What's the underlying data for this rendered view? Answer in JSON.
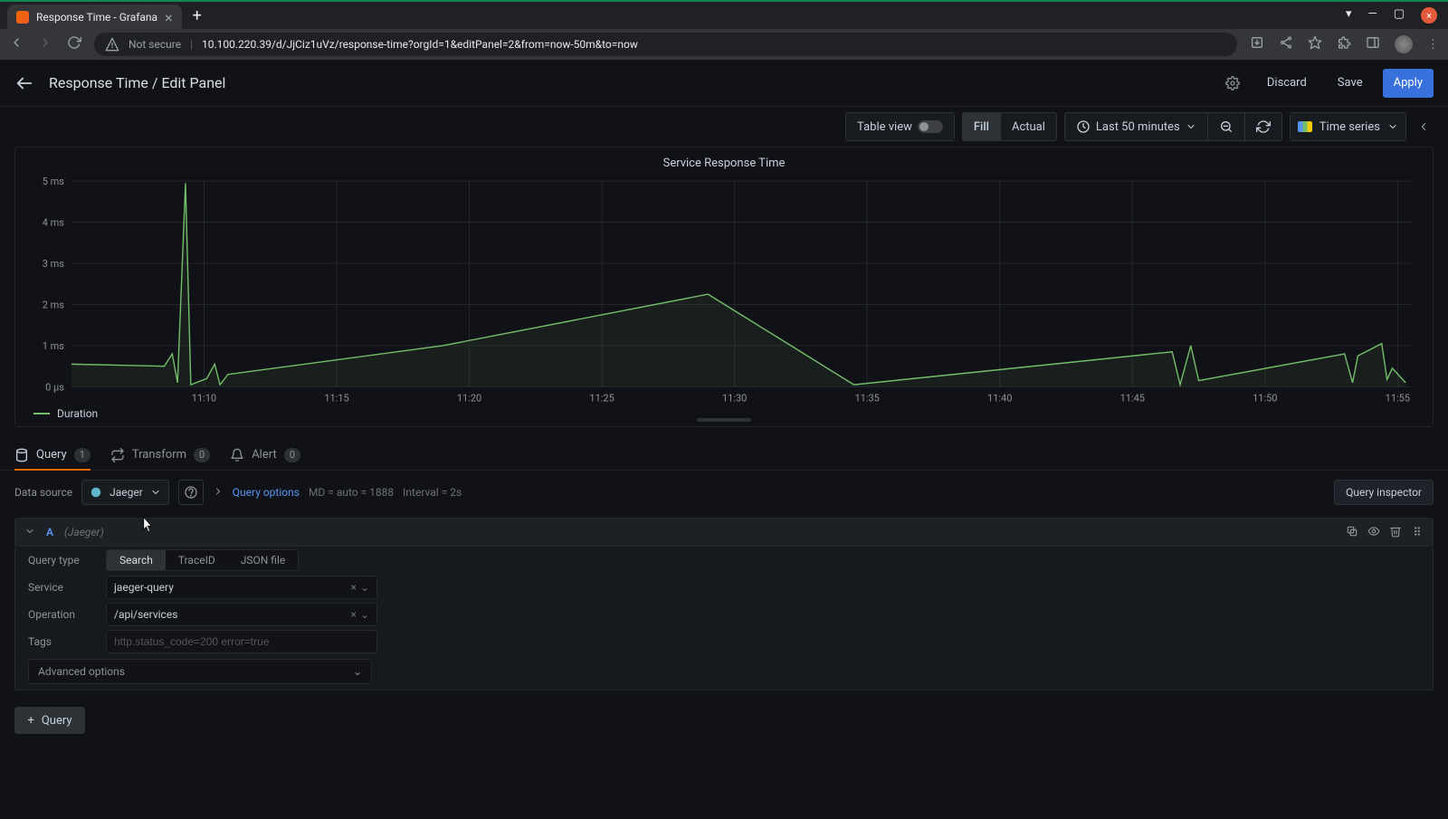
{
  "browser": {
    "tab_title": "Response Time - Grafana",
    "not_secure_label": "Not secure",
    "url": "10.100.220.39/d/JjCiz1uVz/response-time?orgId=1&editPanel=2&from=now-50m&to=now"
  },
  "header": {
    "title": "Response Time / Edit Panel",
    "discard": "Discard",
    "save": "Save",
    "apply": "Apply"
  },
  "toolbar": {
    "table_view": "Table view",
    "fill": "Fill",
    "actual": "Actual",
    "time_range": "Last 50 minutes",
    "panel_type": "Time series"
  },
  "panel": {
    "title": "Service Response Time",
    "legend": "Duration"
  },
  "chart_data": {
    "type": "line",
    "title": "Service Response Time",
    "xlabel": "",
    "ylabel": "",
    "x_ticks": [
      "11:10",
      "11:15",
      "11:20",
      "11:25",
      "11:30",
      "11:35",
      "11:40",
      "11:45",
      "11:50",
      "11:55"
    ],
    "y_ticks": [
      "0 µs",
      "1 ms",
      "2 ms",
      "3 ms",
      "4 ms",
      "5 ms"
    ],
    "ylim_ms": [
      0,
      5
    ],
    "x_range_minutes": [
      0,
      50.5
    ],
    "series": [
      {
        "name": "Duration",
        "color": "#73bf69",
        "points_ms": [
          [
            0.0,
            0.55
          ],
          [
            3.5,
            0.5
          ],
          [
            3.8,
            0.8
          ],
          [
            4.0,
            0.1
          ],
          [
            4.3,
            4.95
          ],
          [
            4.5,
            0.05
          ],
          [
            5.1,
            0.2
          ],
          [
            5.4,
            0.55
          ],
          [
            5.6,
            0.05
          ],
          [
            5.9,
            0.3
          ],
          [
            14.0,
            1.0
          ],
          [
            24.0,
            2.25
          ],
          [
            29.5,
            0.05
          ],
          [
            41.5,
            0.85
          ],
          [
            41.8,
            0.05
          ],
          [
            42.2,
            1.0
          ],
          [
            42.5,
            0.15
          ],
          [
            48.0,
            0.8
          ],
          [
            48.3,
            0.1
          ],
          [
            48.5,
            0.75
          ],
          [
            49.4,
            1.05
          ],
          [
            49.6,
            0.18
          ],
          [
            49.8,
            0.45
          ],
          [
            50.3,
            0.1
          ]
        ]
      }
    ]
  },
  "tabs": {
    "query": "Query",
    "query_count": "1",
    "transform": "Transform",
    "transform_count": "0",
    "alert": "Alert",
    "alert_count": "0"
  },
  "datasource_row": {
    "label": "Data source",
    "name": "Jaeger",
    "query_options": "Query options",
    "md": "MD = auto = 1888",
    "interval": "Interval = 2s",
    "inspector": "Query inspector"
  },
  "query_a": {
    "letter": "A",
    "source": "(Jaeger)",
    "fields": {
      "query_type_label": "Query type",
      "query_type_options": {
        "search": "Search",
        "traceid": "TraceID",
        "jsonfile": "JSON file"
      },
      "service_label": "Service",
      "service_value": "jaeger-query",
      "operation_label": "Operation",
      "operation_value": "/api/services",
      "tags_label": "Tags",
      "tags_placeholder": "http.status_code=200 error=true",
      "advanced_label": "Advanced options"
    }
  },
  "add_query": "Query"
}
